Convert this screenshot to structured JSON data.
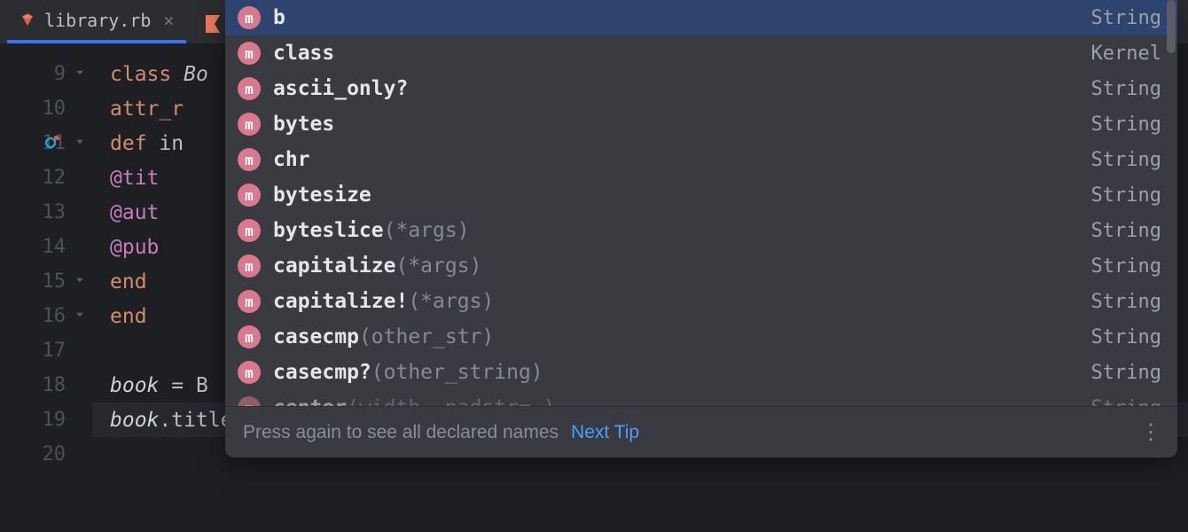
{
  "tab": {
    "filename": "library.rb"
  },
  "gutter": {
    "start": 9,
    "end": 20,
    "marker_line": 11
  },
  "code": {
    "lines": [
      {
        "n": 9,
        "indent": 0,
        "tokens": [
          [
            "kw",
            "class "
          ],
          [
            "cls",
            "Bo"
          ]
        ]
      },
      {
        "n": 10,
        "indent": 1,
        "tokens": [
          [
            "kw",
            "attr_r"
          ]
        ]
      },
      {
        "n": 11,
        "indent": 1,
        "tokens": [
          [
            "kw",
            "def "
          ],
          [
            "var",
            "in"
          ]
        ]
      },
      {
        "n": 12,
        "indent": 2,
        "tokens": [
          [
            "ident",
            "@tit"
          ]
        ]
      },
      {
        "n": 13,
        "indent": 2,
        "tokens": [
          [
            "ident",
            "@aut"
          ]
        ]
      },
      {
        "n": 14,
        "indent": 2,
        "tokens": [
          [
            "ident",
            "@pub"
          ]
        ]
      },
      {
        "n": 15,
        "indent": 1,
        "tokens": [
          [
            "kw",
            "end"
          ]
        ]
      },
      {
        "n": 16,
        "indent": 0,
        "tokens": [
          [
            "kw",
            "end"
          ]
        ]
      },
      {
        "n": 17,
        "indent": 0,
        "tokens": []
      },
      {
        "n": 18,
        "indent": 0,
        "tokens": [
          [
            "lvar",
            "book"
          ],
          [
            "op",
            " = "
          ],
          [
            "var",
            "B"
          ]
        ]
      },
      {
        "n": 19,
        "indent": 0,
        "tokens": [
          [
            "lvar",
            "book"
          ],
          [
            "op",
            ".title."
          ]
        ],
        "current": true,
        "caret": true
      },
      {
        "n": 20,
        "indent": 0,
        "tokens": []
      }
    ]
  },
  "popup": {
    "items": [
      {
        "name": "b",
        "args": "",
        "origin": "String",
        "selected": true
      },
      {
        "name": "class",
        "args": "",
        "origin": "Kernel"
      },
      {
        "name": "ascii_only?",
        "args": "",
        "origin": "String"
      },
      {
        "name": "bytes",
        "args": "",
        "origin": "String"
      },
      {
        "name": "chr",
        "args": "",
        "origin": "String"
      },
      {
        "name": "bytesize",
        "args": "",
        "origin": "String"
      },
      {
        "name": "byteslice",
        "args": "(*args)",
        "origin": "String"
      },
      {
        "name": "capitalize",
        "args": "(*args)",
        "origin": "String"
      },
      {
        "name": "capitalize!",
        "args": "(*args)",
        "origin": "String"
      },
      {
        "name": "casecmp",
        "args": "(other_str)",
        "origin": "String"
      },
      {
        "name": "casecmp?",
        "args": "(other_string)",
        "origin": "String"
      },
      {
        "name": "center",
        "args": "(width, padstr= )",
        "origin": "String",
        "cutoff": true
      }
    ],
    "footer_hint": "Press again to see all declared names",
    "next_tip": "Next Tip"
  }
}
